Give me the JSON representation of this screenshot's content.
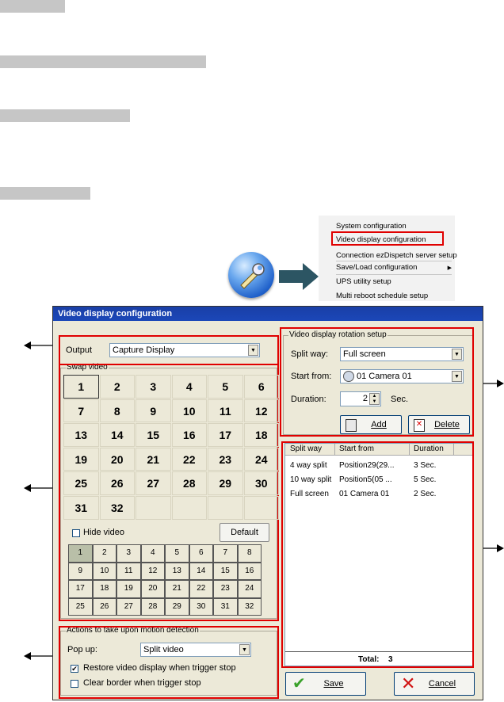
{
  "menu": {
    "items": [
      "System configuration",
      "Video display configuration",
      "Connection ezDispetch server setup",
      "Save/Load configuration",
      "UPS utility setup",
      "Multi reboot schedule setup"
    ],
    "submenu_arrow": "▶"
  },
  "dialog": {
    "title": "Video display configuration",
    "output": {
      "label": "Output",
      "value": "Capture Display"
    },
    "swap_video": {
      "group_label": "Swap video",
      "numbers": [
        "1",
        "2",
        "3",
        "4",
        "5",
        "6",
        "7",
        "8",
        "9",
        "10",
        "11",
        "12",
        "13",
        "14",
        "15",
        "16",
        "17",
        "18",
        "19",
        "20",
        "21",
        "22",
        "23",
        "24",
        "25",
        "26",
        "27",
        "28",
        "29",
        "30",
        "31",
        "32"
      ],
      "hide_video_label": "Hide video",
      "default_button": "Default",
      "channels": [
        "1",
        "2",
        "3",
        "4",
        "5",
        "6",
        "7",
        "8",
        "9",
        "10",
        "11",
        "12",
        "13",
        "14",
        "15",
        "16",
        "17",
        "18",
        "19",
        "20",
        "21",
        "22",
        "23",
        "24",
        "25",
        "26",
        "27",
        "28",
        "29",
        "30",
        "31",
        "32"
      ]
    },
    "motion": {
      "group_label": "Actions to take upon motion detection",
      "popup_label": "Pop up:",
      "popup_value": "Split video",
      "restore_label": "Restore video display when trigger stop",
      "restore_checked": "✔",
      "clear_label": "Clear border when trigger stop"
    },
    "rotation": {
      "group_label": "Video display rotation setup",
      "split_label": "Split way:",
      "split_value": "Full screen",
      "start_label": "Start from:",
      "start_value": "01 Camera 01",
      "duration_label": "Duration:",
      "duration_value": "2",
      "sec_label": "Sec.",
      "add_button": "Add",
      "delete_button": "Delete"
    },
    "list": {
      "headers": [
        "Split way",
        "Start from",
        "Duration"
      ],
      "rows": [
        [
          "4 way split",
          "Position29(29...",
          "3 Sec."
        ],
        [
          "10 way split",
          "Position5(05 ...",
          "5 Sec."
        ],
        [
          "Full screen",
          "01 Camera 01",
          "2 Sec."
        ]
      ],
      "total_label": "Total:",
      "total_value": "3"
    },
    "save_button": "Save",
    "cancel_button": "Cancel"
  },
  "colors": {
    "accent_red": "#e00000",
    "title_blue": "#1b47b8",
    "dialog_bg": "#ece9d8"
  }
}
